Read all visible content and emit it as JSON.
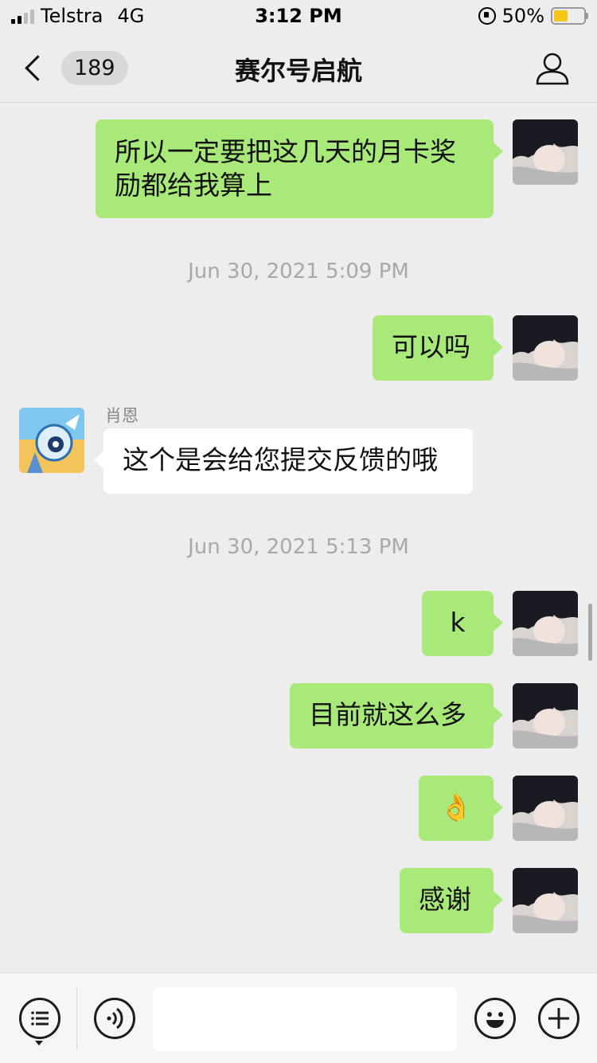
{
  "status_bar": {
    "carrier": "Telstra",
    "network": "4G",
    "time": "3:12 PM",
    "battery_percent": "50%"
  },
  "nav": {
    "unread_count": "189",
    "title": "赛尔号启航"
  },
  "messages": [
    {
      "type": "outgoing",
      "text_line1": "所以一定要把这几天的月卡奖",
      "text_line2": "励都给我算上"
    },
    {
      "type": "timestamp",
      "text": "Jun 30, 2021 5:09 PM"
    },
    {
      "type": "outgoing",
      "text": "可以吗"
    },
    {
      "type": "incoming",
      "sender": "肖恩",
      "text": "这个是会给您提交反馈的哦"
    },
    {
      "type": "timestamp",
      "text": "Jun 30, 2021 5:13 PM"
    },
    {
      "type": "outgoing",
      "text": "k"
    },
    {
      "type": "outgoing",
      "text": "目前就这么多"
    },
    {
      "type": "outgoing",
      "text": "👌"
    },
    {
      "type": "outgoing",
      "text": "感谢"
    }
  ],
  "input_bar": {
    "input_value": "",
    "icons": [
      "menu-list-icon",
      "voice-icon",
      "emoji-icon",
      "plus-icon"
    ]
  },
  "colors": {
    "background": "#ededed",
    "outgoing_bubble": "#a9e979",
    "incoming_bubble": "#ffffff",
    "battery_fill": "#f5c518"
  }
}
